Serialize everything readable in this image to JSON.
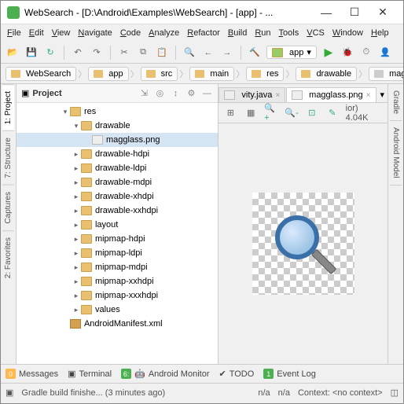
{
  "window": {
    "title": "WebSearch - [D:\\Android\\Examples\\WebSearch] - [app] - ...",
    "min": "—",
    "max": "☐",
    "close": "✕"
  },
  "menu": [
    "File",
    "Edit",
    "View",
    "Navigate",
    "Code",
    "Analyze",
    "Refactor",
    "Build",
    "Run",
    "Tools",
    "VCS",
    "Window",
    "Help"
  ],
  "toolbar": {
    "app_selector": "app"
  },
  "breadcrumbs": [
    "WebSearch",
    "app",
    "src",
    "main",
    "res",
    "drawable",
    "magglass.png"
  ],
  "left_tabs": [
    "1: Project",
    "7: Structure",
    "Captures",
    "2: Favorites"
  ],
  "right_tabs": [
    "Gradle",
    "Android Model"
  ],
  "project": {
    "label": "Project",
    "tree": [
      {
        "depth": 4,
        "arrow": "▾",
        "icon": "folder",
        "label": "res"
      },
      {
        "depth": 5,
        "arrow": "▾",
        "icon": "folder",
        "label": "drawable"
      },
      {
        "depth": 6,
        "arrow": "",
        "icon": "file",
        "label": "magglass.png",
        "selected": true
      },
      {
        "depth": 5,
        "arrow": "▸",
        "icon": "folder",
        "label": "drawable-hdpi"
      },
      {
        "depth": 5,
        "arrow": "▸",
        "icon": "folder",
        "label": "drawable-ldpi"
      },
      {
        "depth": 5,
        "arrow": "▸",
        "icon": "folder",
        "label": "drawable-mdpi"
      },
      {
        "depth": 5,
        "arrow": "▸",
        "icon": "folder",
        "label": "drawable-xhdpi"
      },
      {
        "depth": 5,
        "arrow": "▸",
        "icon": "folder",
        "label": "drawable-xxhdpi"
      },
      {
        "depth": 5,
        "arrow": "▸",
        "icon": "folder",
        "label": "layout"
      },
      {
        "depth": 5,
        "arrow": "▸",
        "icon": "folder",
        "label": "mipmap-hdpi"
      },
      {
        "depth": 5,
        "arrow": "▸",
        "icon": "folder",
        "label": "mipmap-ldpi"
      },
      {
        "depth": 5,
        "arrow": "▸",
        "icon": "folder",
        "label": "mipmap-mdpi"
      },
      {
        "depth": 5,
        "arrow": "▸",
        "icon": "folder",
        "label": "mipmap-xxhdpi"
      },
      {
        "depth": 5,
        "arrow": "▸",
        "icon": "folder",
        "label": "mipmap-xxxhdpi"
      },
      {
        "depth": 5,
        "arrow": "▸",
        "icon": "folder",
        "label": "values"
      },
      {
        "depth": 4,
        "arrow": "",
        "icon": "xml",
        "label": "AndroidManifest.xml"
      }
    ]
  },
  "editor": {
    "tabs": [
      {
        "label": "vity.java",
        "active": false
      },
      {
        "label": "magglass.png",
        "active": true
      }
    ],
    "image_info": "ior) 4.04K"
  },
  "bottom_tabs": [
    {
      "num": "0",
      "color": "#ffb84d",
      "label": "Messages"
    },
    {
      "num": "",
      "color": "",
      "label": "Terminal",
      "icon": "▣"
    },
    {
      "num": "6:",
      "color": "#4caf50",
      "label": "Android Monitor",
      "icon": "🤖"
    },
    {
      "num": "",
      "color": "",
      "label": "TODO",
      "icon": "✔"
    },
    {
      "num": "1",
      "color": "#4caf50",
      "label": "Event Log"
    }
  ],
  "status": {
    "build": "Gradle build finishe... (3 minutes ago)",
    "na1": "n/a",
    "na2": "n/a",
    "context": "Context: <no context>"
  }
}
